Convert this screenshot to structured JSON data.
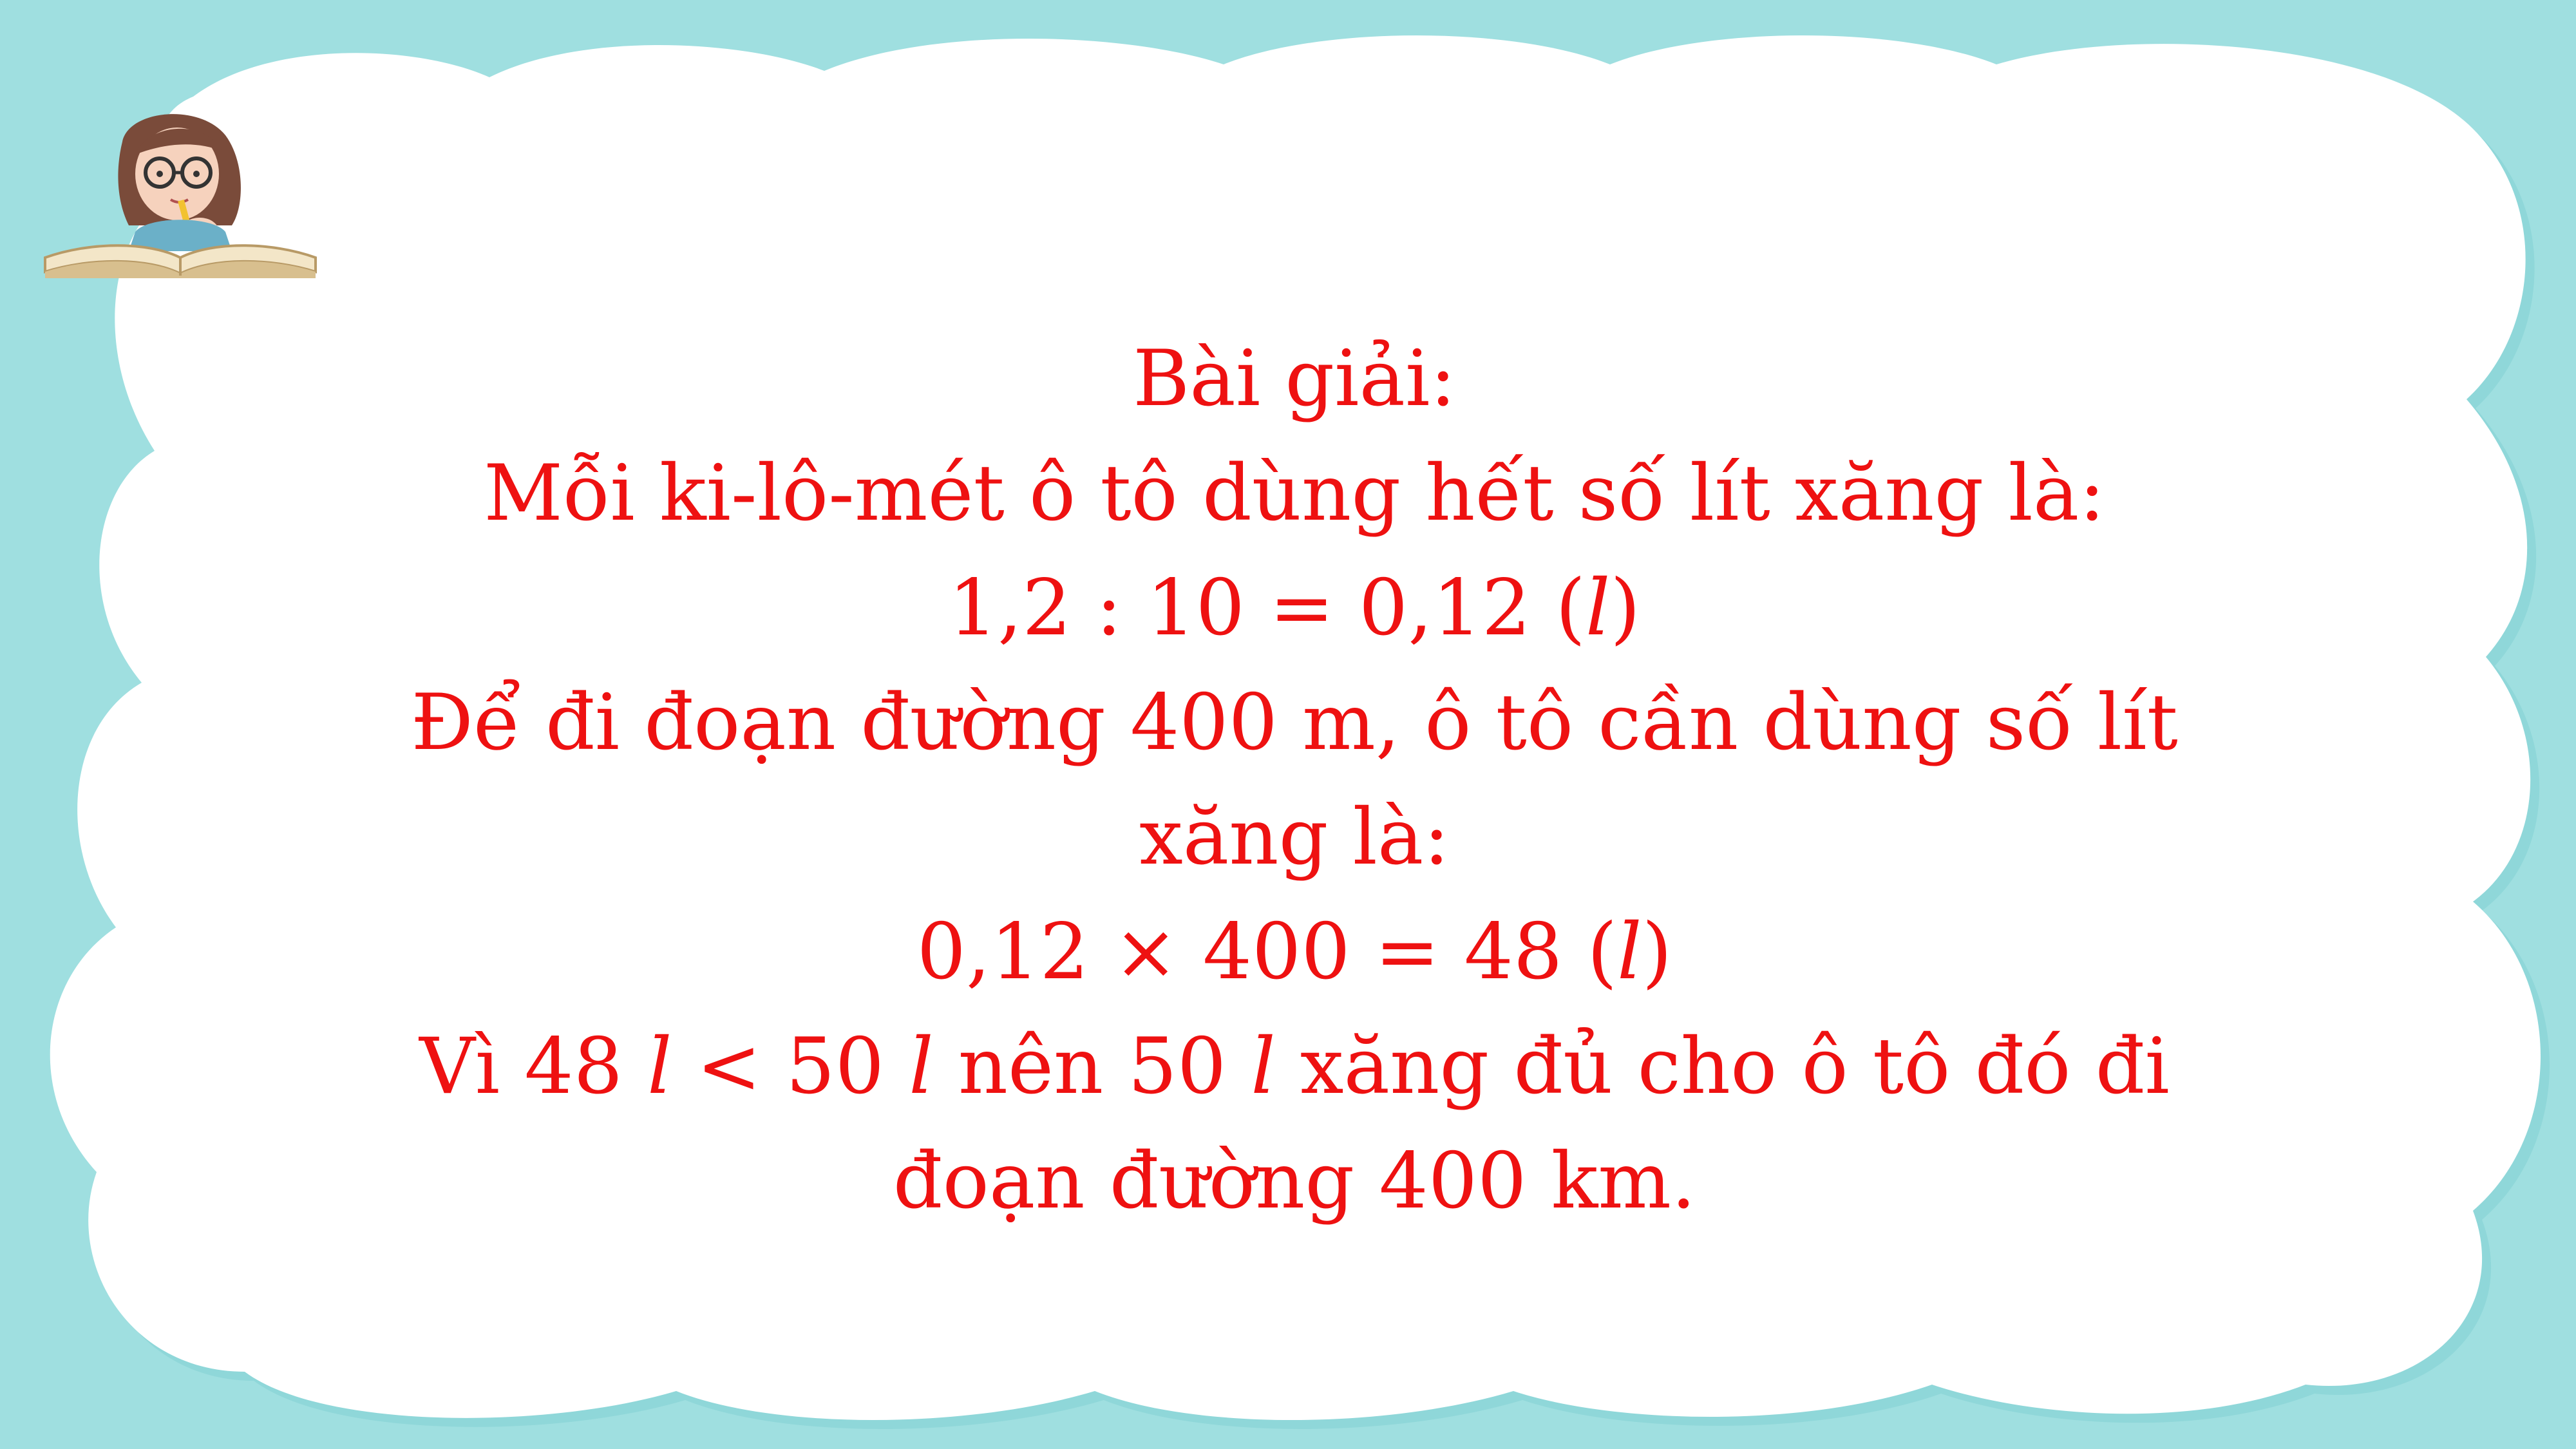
{
  "solution": {
    "heading": "Bài giải:",
    "line1": "Mỗi ki-lô-mét ô tô dùng hết số lít xăng là:",
    "calc1_prefix": "1,2 : 10 = 0,12 (",
    "calc1_unit": "l",
    "calc1_suffix": ")",
    "line2a": "Để đi đoạn đường 400 m, ô tô cần dùng số lít",
    "line2b": "xăng là:",
    "calc2_prefix": "0,12 × 400 = 48 (",
    "calc2_unit": "l",
    "calc2_suffix": ")",
    "conclusion_part1": "Vì 48 ",
    "conclusion_unit1": "l",
    "conclusion_part2": " < 50 ",
    "conclusion_unit2": "l",
    "conclusion_part3": " nên 50 ",
    "conclusion_unit3": "l",
    "conclusion_part4": " xăng đủ cho ô tô đó đi",
    "conclusion_line2": "đoạn đường 400 km."
  },
  "colors": {
    "background": "#9fdfe0",
    "cloud": "#ffffff",
    "text": "#ee1111"
  },
  "icons": {
    "corner_illustration": "girl-reading-book-icon"
  }
}
